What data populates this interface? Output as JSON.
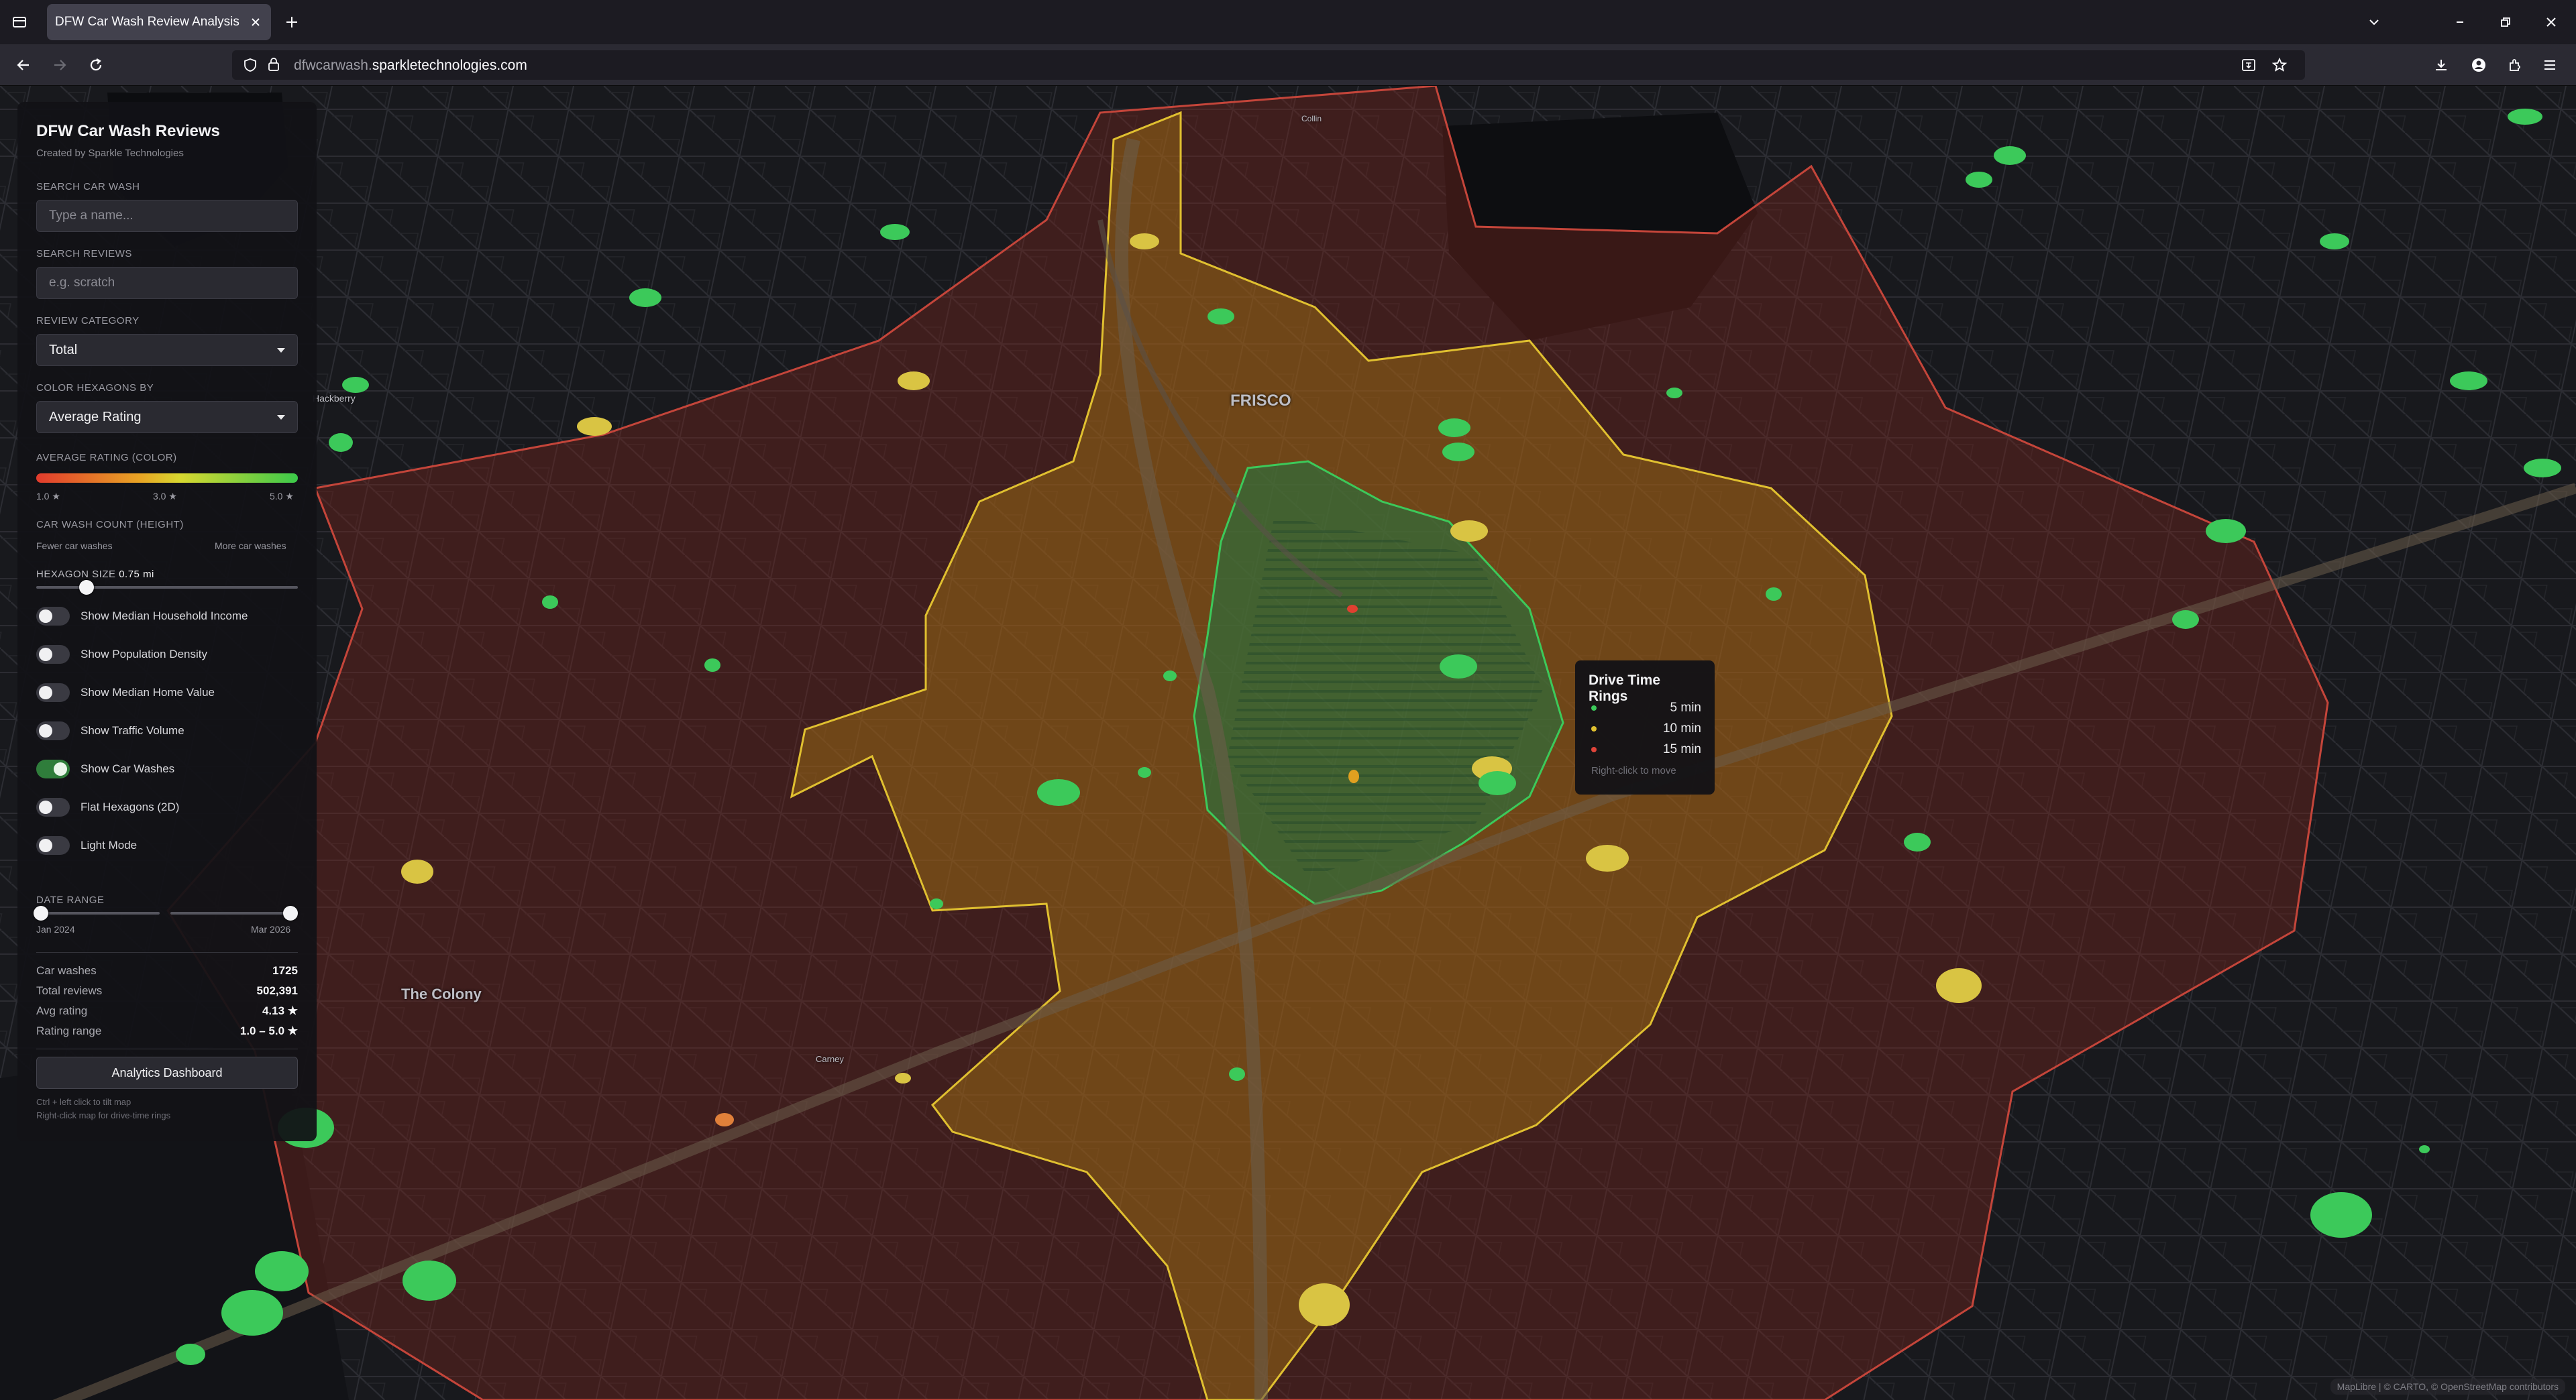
{
  "browser": {
    "tab_title": "DFW Car Wash Review Analysis",
    "url_prefix": "dfwcarwash.",
    "url_domain": "sparkletechnologies.com"
  },
  "map": {
    "labels": {
      "frisco": "FRISCO",
      "the_colony": "The Colony",
      "hackberry": "Hackberry",
      "carney": "Carney",
      "collin": "Collin"
    },
    "attribution": "MapLibre | © CARTO, © OpenStreetMap contributors"
  },
  "panel": {
    "title": "DFW Car Wash Reviews",
    "subtitle": "Created by Sparkle Technologies",
    "search_car_wash_label": "SEARCH CAR WASH",
    "search_car_wash_placeholder": "Type a name...",
    "search_reviews_label": "SEARCH REVIEWS",
    "search_reviews_placeholder": "e.g. scratch",
    "review_category_label": "REVIEW CATEGORY",
    "review_category_value": "Total",
    "color_by_label": "COLOR HEXAGONS BY",
    "color_by_value": "Average Rating",
    "avg_rating_label": "AVERAGE RATING (COLOR)",
    "rating_min": "1.0 ★",
    "rating_mid": "3.0 ★",
    "rating_max": "5.0 ★",
    "count_label": "CAR WASH COUNT (HEIGHT)",
    "fewer_label": "Fewer car washes",
    "more_label": "More car washes",
    "hex_size_label": "HEXAGON SIZE",
    "hex_size_value": "0.75 mi",
    "toggles": [
      {
        "label": "Show Median Household Income",
        "on": false
      },
      {
        "label": "Show Population Density",
        "on": false
      },
      {
        "label": "Show Median Home Value",
        "on": false
      },
      {
        "label": "Show Traffic Volume",
        "on": false
      },
      {
        "label": "Show Car Washes",
        "on": true
      },
      {
        "label": "Flat Hexagons (2D)",
        "on": false
      },
      {
        "label": "Light Mode",
        "on": false
      }
    ],
    "date_range_label": "DATE RANGE",
    "date_start": "Jan 2024",
    "date_end": "Mar 2026",
    "stats": [
      {
        "k": "Car washes",
        "v": "1725"
      },
      {
        "k": "Total reviews",
        "v": "502,391"
      },
      {
        "k": "Avg rating",
        "v": "4.13 ★"
      },
      {
        "k": "Rating range",
        "v": "1.0 – 5.0 ★"
      }
    ],
    "dashboard_button": "Analytics Dashboard",
    "hint1": "Ctrl + left click to tilt map",
    "hint2": "Right-click map for drive-time rings"
  },
  "rings": {
    "title": "Drive Time Rings",
    "items": [
      {
        "label": "5 min",
        "color": "#3cc95a"
      },
      {
        "label": "10 min",
        "color": "#e0c030"
      },
      {
        "label": "15 min",
        "color": "#e0443a"
      }
    ],
    "hint": "Right-click to move"
  },
  "colors": {
    "ring_5": "#3cc95a",
    "ring_10": "#e0c030",
    "ring_15": "#c4453a",
    "toggle_on": "#2f7d3b"
  }
}
